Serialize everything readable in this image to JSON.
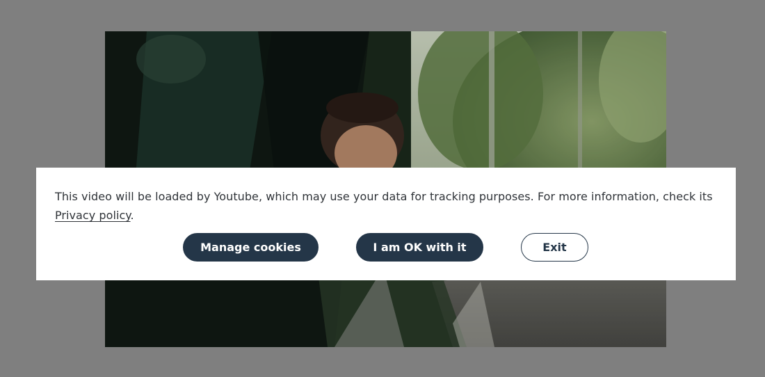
{
  "consent": {
    "message": "This video will be loaded by Youtube, which may use your data for tracking purposes. For more information, check its ",
    "privacy_link": "Privacy policy",
    "message_end": "."
  },
  "buttons": {
    "manage_cookies": "Manage cookies",
    "accept": "I am OK with it",
    "exit": "Exit"
  },
  "colors": {
    "overlay": "#7f7f7f",
    "panel": "#ffffff",
    "button_dark": "#243648",
    "text": "#2f3338"
  }
}
